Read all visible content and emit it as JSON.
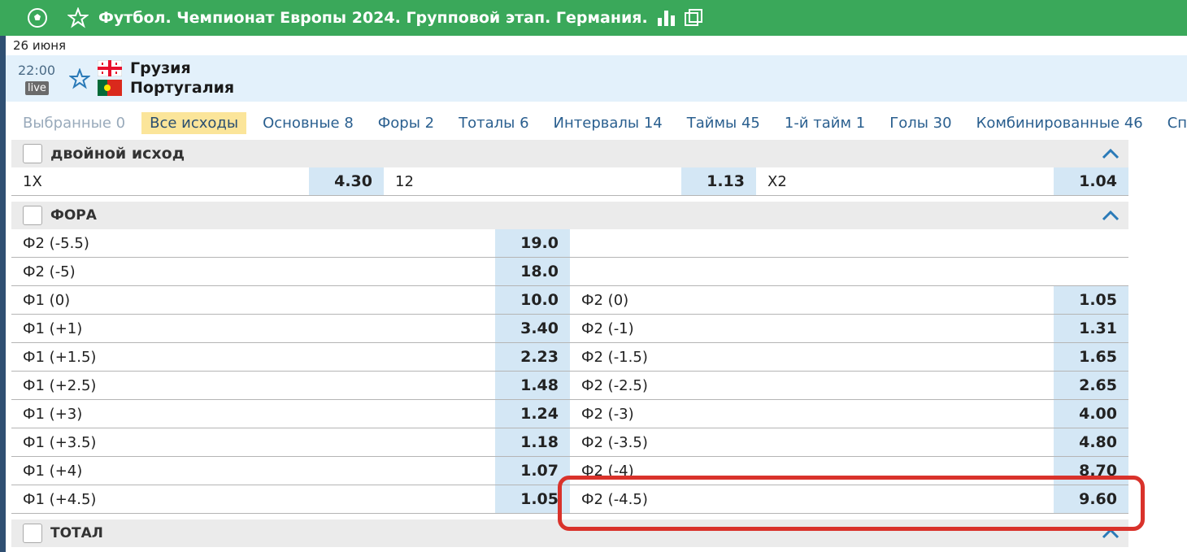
{
  "header": {
    "title": "Футбол. Чемпионат Европы 2024. Групповой этап. Германия.",
    "icons": [
      "soccer-ball-icon",
      "star-icon",
      "stats-icon",
      "popout-icon"
    ]
  },
  "date": "26 июня",
  "match": {
    "time": "22:00",
    "live_label": "live",
    "team1": "Грузия",
    "team2": "Португалия"
  },
  "tabs": [
    {
      "label": "Выбранные 0",
      "state": "disabled"
    },
    {
      "label": "Все исходы",
      "state": "active"
    },
    {
      "label": "Основные 8"
    },
    {
      "label": "Форы 2"
    },
    {
      "label": "Тоталы 6"
    },
    {
      "label": "Интервалы 14"
    },
    {
      "label": "Таймы 45"
    },
    {
      "label": "1-й тайм 1"
    },
    {
      "label": "Голы 30"
    },
    {
      "label": "Комбинированные 46"
    },
    {
      "label": "Спец"
    }
  ],
  "double_chance": {
    "title": "двойной исход",
    "items": [
      {
        "label": "1X",
        "odd": "4.30"
      },
      {
        "label": "12",
        "odd": "1.13"
      },
      {
        "label": "X2",
        "odd": "1.04"
      }
    ]
  },
  "handicap": {
    "title": "ФОРА",
    "rows": [
      {
        "l_label": "Ф2 (-5.5)",
        "l_odd": "19.0",
        "r_label": "",
        "r_odd": ""
      },
      {
        "l_label": "Ф2 (-5)",
        "l_odd": "18.0",
        "r_label": "",
        "r_odd": ""
      },
      {
        "l_label": "Ф1 (0)",
        "l_odd": "10.0",
        "r_label": "Ф2 (0)",
        "r_odd": "1.05"
      },
      {
        "l_label": "Ф1 (+1)",
        "l_odd": "3.40",
        "r_label": "Ф2 (-1)",
        "r_odd": "1.31"
      },
      {
        "l_label": "Ф1 (+1.5)",
        "l_odd": "2.23",
        "r_label": "Ф2 (-1.5)",
        "r_odd": "1.65"
      },
      {
        "l_label": "Ф1 (+2.5)",
        "l_odd": "1.48",
        "r_label": "Ф2 (-2.5)",
        "r_odd": "2.65"
      },
      {
        "l_label": "Ф1 (+3)",
        "l_odd": "1.24",
        "r_label": "Ф2 (-3)",
        "r_odd": "4.00"
      },
      {
        "l_label": "Ф1 (+3.5)",
        "l_odd": "1.18",
        "r_label": "Ф2 (-3.5)",
        "r_odd": "4.80"
      },
      {
        "l_label": "Ф1 (+4)",
        "l_odd": "1.07",
        "r_label": "Ф2 (-4)",
        "r_odd": "8.70"
      },
      {
        "l_label": "Ф1 (+4.5)",
        "l_odd": "1.05",
        "r_label": "Ф2 (-4.5)",
        "r_odd": "9.60"
      }
    ]
  },
  "total": {
    "title": "ТОТАЛ"
  },
  "colors": {
    "header_green": "#3aa85a",
    "odd_bg": "#d4e7f5",
    "active_tab": "#fbe59a",
    "highlight": "#d9322b"
  }
}
